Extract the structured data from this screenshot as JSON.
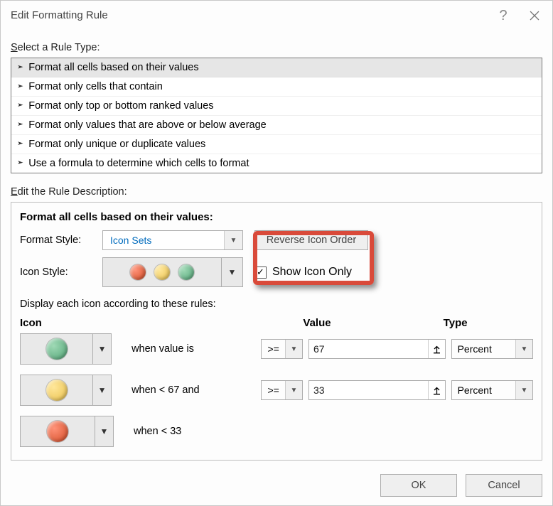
{
  "window": {
    "title": "Edit Formatting Rule"
  },
  "sections": {
    "select_label_pre": "S",
    "select_label_post": "elect a Rule Type:",
    "edit_label_pre": "E",
    "edit_label_post": "dit the Rule Description:"
  },
  "rule_types": [
    "Format all cells based on their values",
    "Format only cells that contain",
    "Format only top or bottom ranked values",
    "Format only values that are above or below average",
    "Format only unique or duplicate values",
    "Use a formula to determine which cells to format"
  ],
  "desc": {
    "title": "Format all cells based on their values:",
    "format_style_label": "Format Style:",
    "format_style_value": "Icon Sets",
    "reverse_btn": "Reverse Icon Order",
    "icon_style_label": "Icon Style:",
    "show_icon_only_label": "Show Icon Only",
    "show_icon_only_checked": true,
    "rules_label": "Display each icon according to these rules:",
    "col_icon": "Icon",
    "col_value": "Value",
    "col_type": "Type",
    "rows": [
      {
        "color": "green",
        "when": "when value is",
        "op": ">=",
        "value": "67",
        "type": "Percent"
      },
      {
        "color": "amber",
        "when": "when < 67 and",
        "op": ">=",
        "value": "33",
        "type": "Percent"
      },
      {
        "color": "red",
        "when": "when < 33",
        "op": "",
        "value": "",
        "type": ""
      }
    ]
  },
  "buttons": {
    "ok": "OK",
    "cancel": "Cancel"
  }
}
